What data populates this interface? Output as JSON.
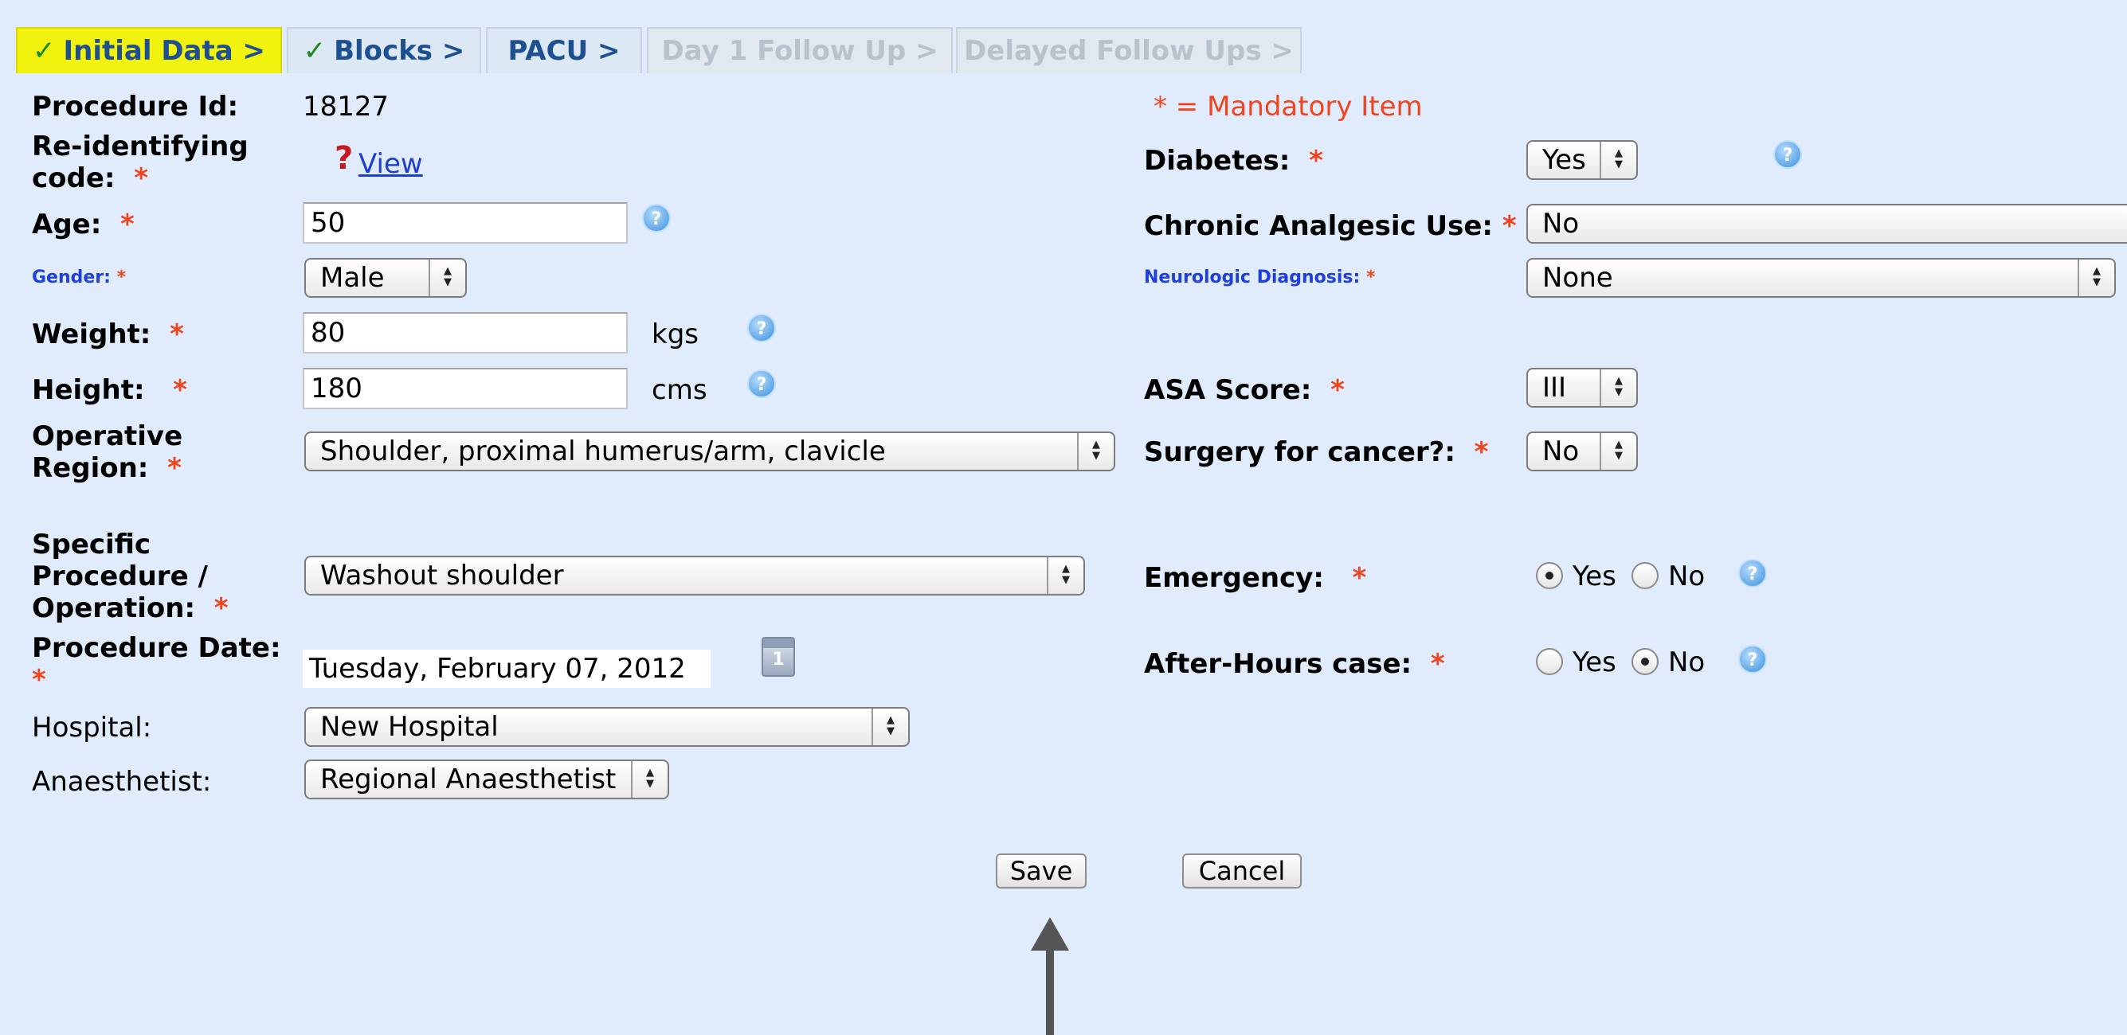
{
  "tabs": [
    {
      "label": "Initial Data >",
      "check": "✓"
    },
    {
      "label": "Blocks >",
      "check": "✓"
    },
    {
      "label": "PACU >"
    },
    {
      "label": "Day 1 Follow Up >"
    },
    {
      "label": "Delayed Follow Ups >"
    }
  ],
  "form": {
    "procedure_id_label": "Procedure Id:",
    "procedure_id_value": "18127",
    "mandatory_note": "* = Mandatory Item",
    "reid_label_1": "Re-identifying",
    "reid_label_2": "code:",
    "reid_link": " View",
    "reid_icon": "?",
    "age_label": "Age:",
    "age_value": "50",
    "gender_label": "Gender:",
    "gender_value": "Male",
    "weight_label": "Weight:",
    "weight_value": "80",
    "weight_unit": "kgs",
    "height_label": "Height:",
    "height_value": "180",
    "height_unit": "cms",
    "op_region_label_1": "Operative",
    "op_region_label_2": "Region:",
    "op_region_value": "Shoulder, proximal humerus/arm, clavicle",
    "specific_label_1": "Specific",
    "specific_label_2": "Procedure /",
    "specific_label_3": "Operation:",
    "specific_value": "Washout shoulder",
    "date_label_1": "Procedure Date:",
    "date_value": "Tuesday, February 07, 2012",
    "calendar_num": "1",
    "hospital_label": "Hospital:",
    "hospital_value": "New Hospital",
    "anaesthetist_label": "Anaesthetist:",
    "anaesthetist_value": "Regional Anaesthetist",
    "diabetes_label": "Diabetes:",
    "diabetes_value": "Yes",
    "chronic_label": "Chronic Analgesic Use:",
    "chronic_value": "No",
    "neuro_label": "Neurologic Diagnosis:",
    "neuro_value": "None",
    "asa_label": "ASA Score:",
    "asa_value": "III",
    "cancer_label": "Surgery for cancer?:",
    "cancer_value": "No",
    "emergency_label": "Emergency:",
    "emergency_selected": "Yes",
    "afterhours_label": "After-Hours case:",
    "afterhours_selected": "No",
    "yes": "Yes",
    "no": "No",
    "req": "*"
  },
  "buttons": {
    "save": "Save",
    "cancel": "Cancel"
  },
  "icons": {
    "help": "?",
    "select_arrow": "▲▼"
  },
  "colors": {
    "background": "#e0ecfb",
    "active_tab": "#f2f20f",
    "mandatory": "#f0441f",
    "link": "#1d3fd0"
  }
}
